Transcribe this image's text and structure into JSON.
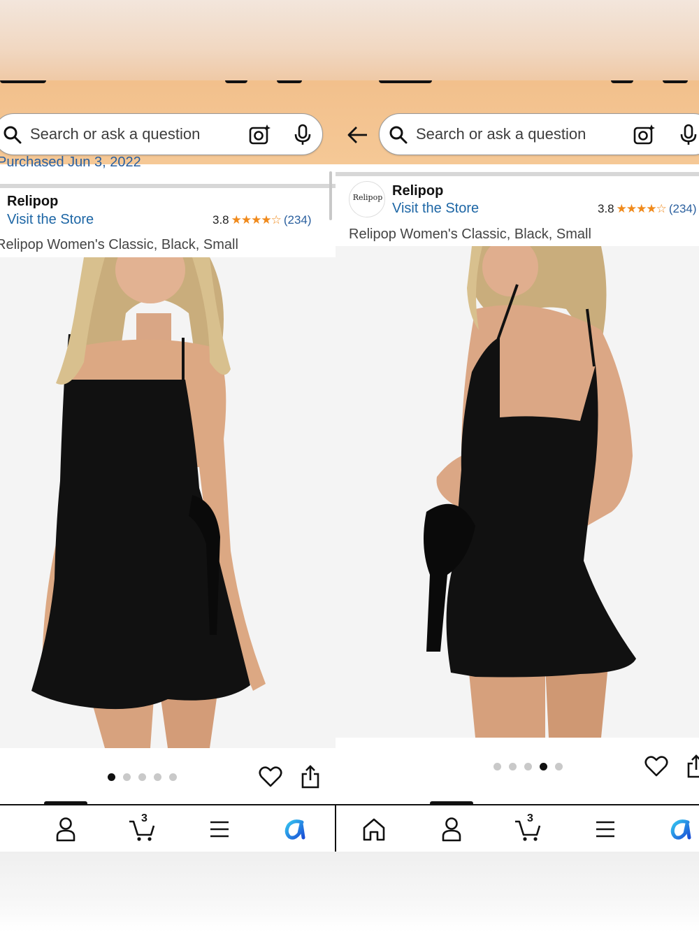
{
  "search": {
    "placeholder": "Search or ask a question"
  },
  "left": {
    "purchased_text": "Purchased Jun 3, 2022",
    "brand": "Relipop",
    "store_link": "Visit the Store",
    "rating": "3.8",
    "stars": "★★★★☆",
    "review_count": "(234)",
    "variant": "Relipop Women's Classic, Black, Small",
    "image_index": 1,
    "image_count": 5,
    "cart_count": "3"
  },
  "right": {
    "brand_logo_text": "Relipop",
    "brand": "Relipop",
    "store_link": "Visit the Store",
    "rating": "3.8",
    "stars": "★★★★☆",
    "review_count": "(234)",
    "variant": "Relipop Women's Classic, Black, Small",
    "image_index": 4,
    "image_count": 5,
    "cart_count": "3"
  },
  "icons": {
    "back": "back-arrow-icon",
    "search": "search-icon",
    "camera": "camera-icon",
    "mic": "mic-icon",
    "wishlist": "heart-icon",
    "share": "share-icon",
    "home": "home-icon",
    "account": "account-icon",
    "cart": "cart-icon",
    "menu": "menu-icon",
    "assistant": "assistant-icon"
  },
  "colors": {
    "header": "#f2c08c",
    "link": "#1d66a5",
    "star": "#f08a1c",
    "dress": "#111111"
  }
}
